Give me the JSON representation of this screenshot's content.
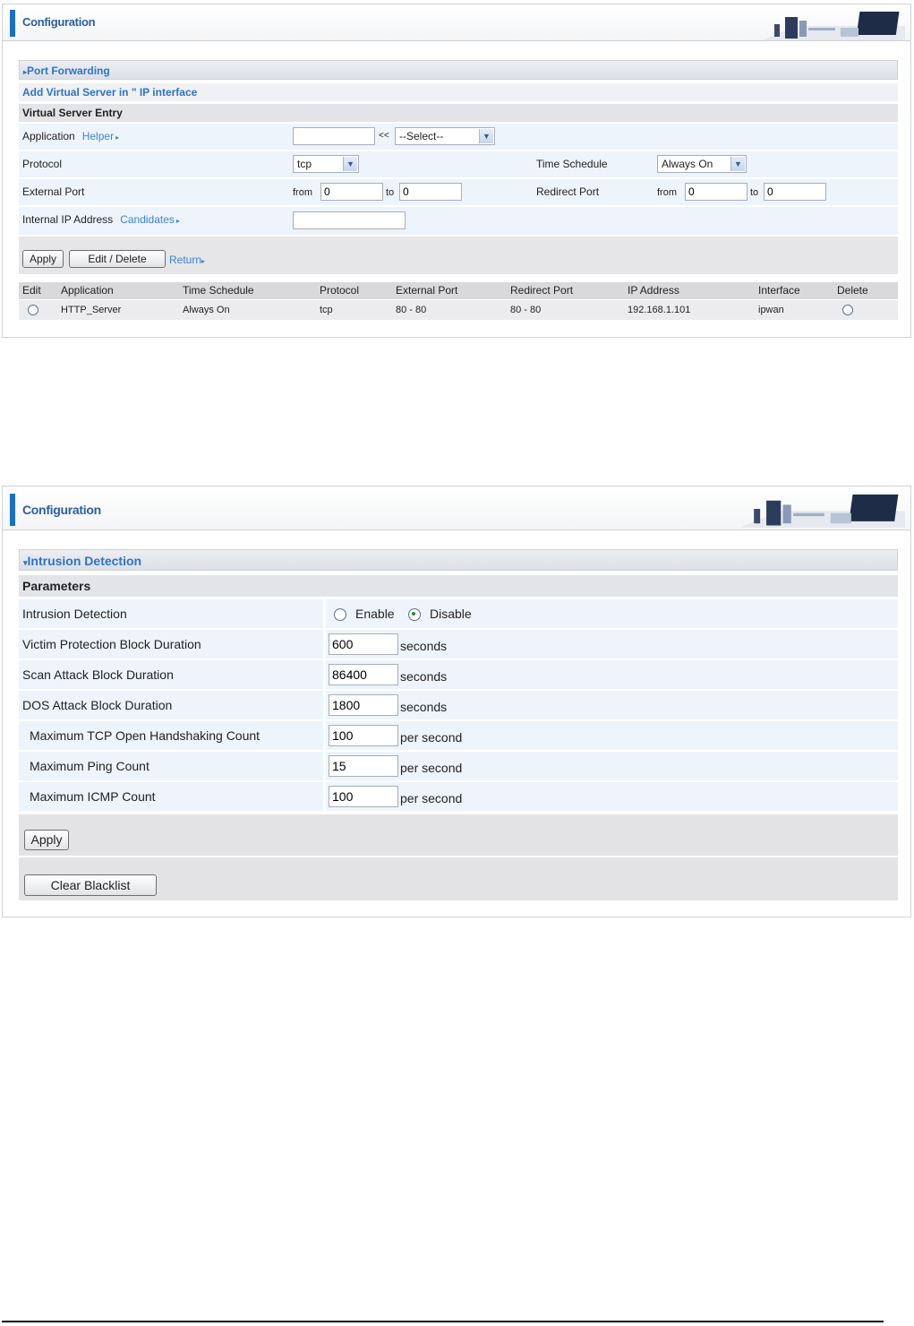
{
  "port_forwarding": {
    "config_title": "Configuration",
    "section_title": "Port Forwarding",
    "sub_title": "Add Virtual Server in \" IP interface",
    "entry_title": "Virtual Server Entry",
    "application_label": "Application",
    "helper_link": "Helper",
    "application_value": "",
    "arrows": "<<",
    "select_value": "--Select--",
    "protocol_label": "Protocol",
    "protocol_value": "tcp",
    "time_schedule_label": "Time Schedule",
    "time_schedule_value": "Always On",
    "external_port_label": "External Port",
    "redirect_port_label": "Redirect Port",
    "from_label": "from",
    "to_label": "to",
    "ext_from": "0",
    "ext_to": "0",
    "red_from": "0",
    "red_to": "0",
    "internal_ip_label": "Internal IP Address",
    "candidates_link": "Candidates",
    "internal_ip_value": "",
    "apply_label": "Apply",
    "edit_delete_label": "Edit / Delete",
    "return_link": "Return",
    "table": {
      "headers": [
        "Edit",
        "Application",
        "Time Schedule",
        "Protocol",
        "External Port",
        "Redirect Port",
        "IP Address",
        "Interface",
        "Delete"
      ],
      "rows": [
        {
          "application": "HTTP_Server",
          "time_schedule": "Always On",
          "protocol": "tcp",
          "external_port": "80 - 80",
          "redirect_port": "80 - 80",
          "ip_address": "192.168.1.101",
          "interface": "ipwan"
        }
      ]
    }
  },
  "intrusion_detection": {
    "config_title": "Configuration",
    "section_title": "Intrusion Detection",
    "params_title": "Parameters",
    "intrusion_label": "Intrusion Detection",
    "enable_label": "Enable",
    "disable_label": "Disable",
    "selected": "Disable",
    "rows": [
      {
        "label": "Victim Protection Block Duration",
        "value": "600",
        "unit": "seconds"
      },
      {
        "label": "Scan Attack Block Duration",
        "value": "86400",
        "unit": "seconds"
      },
      {
        "label": "DOS Attack Block Duration",
        "value": "1800",
        "unit": "seconds"
      },
      {
        "label": "Maximum TCP Open Handshaking Count",
        "value": "100",
        "unit": "per second"
      },
      {
        "label": "Maximum Ping Count",
        "value": "15",
        "unit": "per second"
      },
      {
        "label": "Maximum ICMP Count",
        "value": "100",
        "unit": "per second"
      }
    ],
    "apply_label": "Apply",
    "clear_label": "Clear Blacklist"
  }
}
